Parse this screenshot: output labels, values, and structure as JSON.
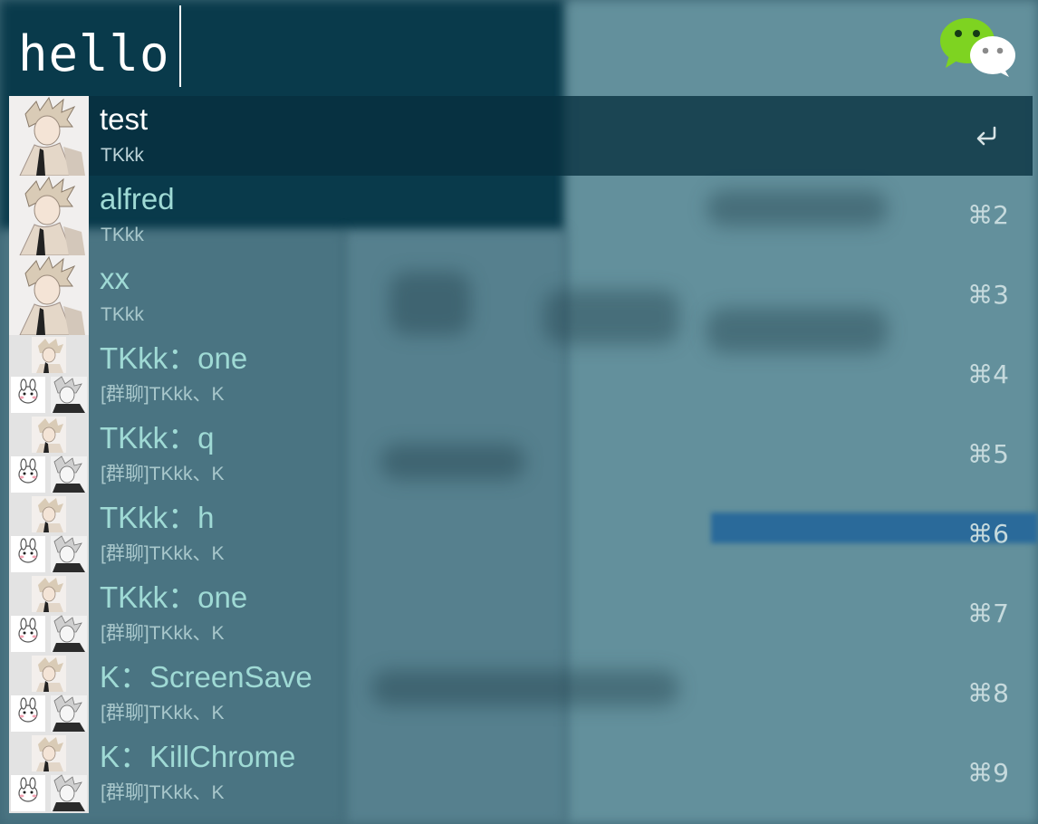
{
  "search": {
    "query": "hello"
  },
  "results": [
    {
      "title": "test",
      "subtitle": "TKkk",
      "shortcut": "↩",
      "selected": true,
      "avatar": "single"
    },
    {
      "title": "alfred",
      "subtitle": "TKkk",
      "shortcut": "⌘2",
      "selected": false,
      "avatar": "single"
    },
    {
      "title": "xx",
      "subtitle": "TKkk",
      "shortcut": "⌘3",
      "selected": false,
      "avatar": "single"
    },
    {
      "title": "TKkk：one",
      "subtitle": "[群聊]TKkk、K",
      "shortcut": "⌘4",
      "selected": false,
      "avatar": "group"
    },
    {
      "title": "TKkk：q",
      "subtitle": "[群聊]TKkk、K",
      "shortcut": "⌘5",
      "selected": false,
      "avatar": "group"
    },
    {
      "title": "TKkk：h",
      "subtitle": "[群聊]TKkk、K",
      "shortcut": "⌘6",
      "selected": false,
      "avatar": "group"
    },
    {
      "title": "TKkk：one",
      "subtitle": "[群聊]TKkk、K",
      "shortcut": "⌘7",
      "selected": false,
      "avatar": "group"
    },
    {
      "title": "K：ScreenSave",
      "subtitle": "[群聊]TKkk、K",
      "shortcut": "⌘8",
      "selected": false,
      "avatar": "group"
    },
    {
      "title": "K：KillChrome",
      "subtitle": "[群聊]TKkk、K",
      "shortcut": "⌘9",
      "selected": false,
      "avatar": "group"
    }
  ],
  "icons": {
    "app": "wechat-icon",
    "enter": "return-key-icon"
  },
  "colors": {
    "accent": "#9fdad5",
    "selected_bg": "#07303f",
    "wechat_green": "#7ed321"
  }
}
